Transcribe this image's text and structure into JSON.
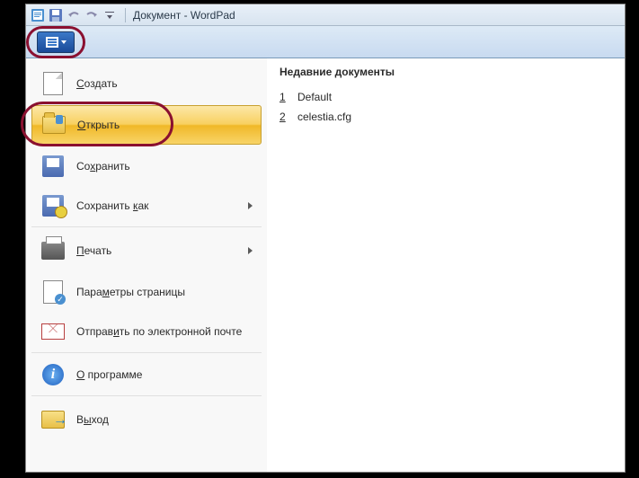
{
  "title": "Документ - WordPad",
  "menu": {
    "new": "<u>С</u>оздать",
    "open": "<u>О</u>ткрыть",
    "save": "Со<u>х</u>ранить",
    "saveas": "Сохранить <u>к</u>ак",
    "print": "<u>П</u>ечать",
    "pagesetup": "Пара<u>м</u>етры страницы",
    "sendmail": "Отправ<u>и</u>ть по электронной почте",
    "about": "<u>О</u> программе",
    "exit": "В<u>ы</u>ход"
  },
  "recent": {
    "header": "Недавние документы",
    "items": [
      {
        "num": "1",
        "name": "Default"
      },
      {
        "num": "2",
        "name": "celestia.cfg"
      }
    ]
  }
}
